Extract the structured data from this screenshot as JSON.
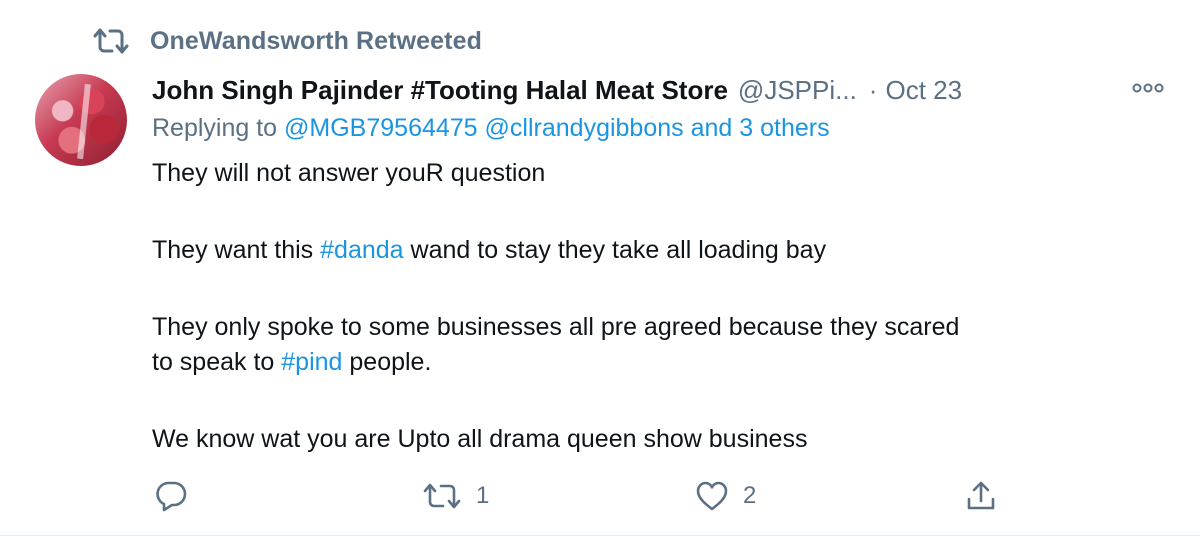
{
  "retweet_context": {
    "label": "OneWandsworth Retweeted",
    "icon": "retweet-icon"
  },
  "tweet": {
    "author_name": "John Singh Pajinder #Tooting Halal Meat Store",
    "author_handle": "@JSPPi...",
    "separator": "·",
    "date": "Oct 23",
    "replying_to": {
      "prefix": "Replying to",
      "mentions": [
        "@MGB79564475",
        "@cllrandygibbons",
        "and 3 others"
      ]
    },
    "body": {
      "line1": "They will not answer youR question",
      "line2_before": "They want this",
      "line2_hashtag": "#danda",
      "line2_after": "wand to stay they take all loading bay",
      "line3_text": "They only spoke to some businesses all pre agreed because they scared",
      "line3_before": "to speak to",
      "line3_hashtag": "#pind",
      "line3_after": "people.",
      "line4": "We know wat you are Upto all drama queen show business"
    },
    "actions": {
      "reply_count": "",
      "retweet_count": "1",
      "like_count": "2"
    }
  },
  "colors": {
    "text_primary": "#0f1419",
    "text_secondary": "#5b7083",
    "link": "#1b95e0"
  }
}
